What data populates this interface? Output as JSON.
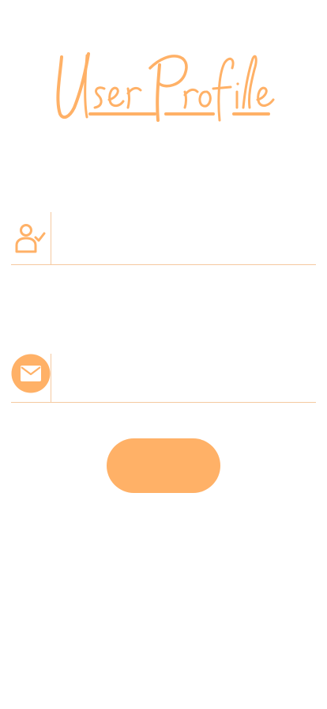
{
  "app": {
    "title_logo_text": "User Profile"
  },
  "form": {
    "name_field": {
      "icon": "user-check-icon",
      "value": "",
      "placeholder": ""
    },
    "email_field": {
      "icon": "envelope-icon",
      "value": "",
      "placeholder": ""
    },
    "submit_button": {
      "label": ""
    }
  },
  "colors": {
    "accent": "#ffb167",
    "divider": "#f5c9a0",
    "background": "#ffffff"
  }
}
